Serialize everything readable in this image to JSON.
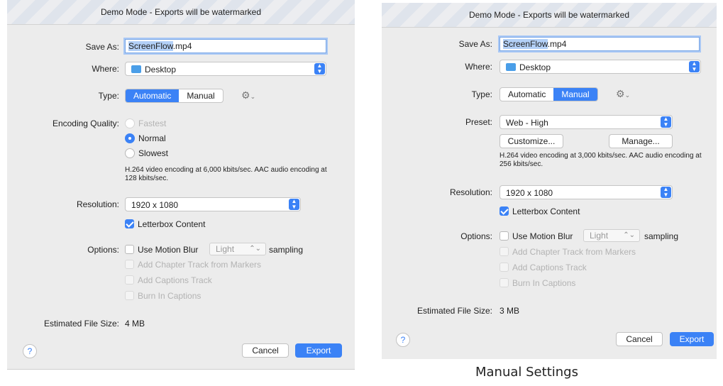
{
  "dialog1": {
    "title": "Demo Mode - Exports will be watermarked",
    "save_as_label": "Save As:",
    "save_as_selected": "ScreenFlow",
    "save_as_ext": ".mp4",
    "where_label": "Where:",
    "where_value": "Desktop",
    "type_label": "Type:",
    "type_options": [
      "Automatic",
      "Manual"
    ],
    "type_selected": "Automatic",
    "encoding_label": "Encoding Quality:",
    "encoding_options": [
      "Fastest",
      "Normal",
      "Slowest"
    ],
    "encoding_selected": "Normal",
    "encoding_desc": "H.264 video encoding at 6,000 kbits/sec.  AAC audio encoding at 128 kbits/sec.",
    "resolution_label": "Resolution:",
    "resolution_value": "1920 x 1080",
    "letterbox_label": "Letterbox Content",
    "options_label": "Options:",
    "motion_blur_label": "Use Motion Blur",
    "blur_level": "Light",
    "sampling_label": "sampling",
    "chapter_label": "Add Chapter Track from Markers",
    "captions_track_label": "Add Captions Track",
    "burn_captions_label": "Burn In Captions",
    "file_size_label": "Estimated File Size:",
    "file_size_value": "4 MB",
    "help_label": "?",
    "cancel_label": "Cancel",
    "export_label": "Export"
  },
  "dialog2": {
    "title": "Demo Mode - Exports will be watermarked",
    "save_as_label": "Save As:",
    "save_as_selected": "ScreenFlow",
    "save_as_ext": ".mp4",
    "where_label": "Where:",
    "where_value": "Desktop",
    "type_label": "Type:",
    "type_options": [
      "Automatic",
      "Manual"
    ],
    "type_selected": "Manual",
    "preset_label": "Preset:",
    "preset_value": "Web - High",
    "customize_label": "Customize...",
    "manage_label": "Manage...",
    "preset_desc": "H.264 video encoding at 3,000 kbits/sec.  AAC audio encoding at 256 kbits/sec.",
    "resolution_label": "Resolution:",
    "resolution_value": "1920 x 1080",
    "letterbox_label": "Letterbox Content",
    "options_label": "Options:",
    "motion_blur_label": "Use Motion Blur",
    "blur_level": "Light",
    "sampling_label": "sampling",
    "chapter_label": "Add Chapter Track from Markers",
    "captions_track_label": "Add Captions Track",
    "burn_captions_label": "Burn In Captions",
    "file_size_label": "Estimated File Size:",
    "file_size_value": "3 MB",
    "help_label": "?",
    "cancel_label": "Cancel",
    "export_label": "Export"
  },
  "caption": "Manual Settings",
  "icons": {
    "gear": "gear-icon",
    "folder": "folder-icon",
    "help": "help-icon",
    "updown": "updown-chevron-icon"
  },
  "colors": {
    "accent": "#3b82f6",
    "dialog_bg": "#ececec"
  }
}
